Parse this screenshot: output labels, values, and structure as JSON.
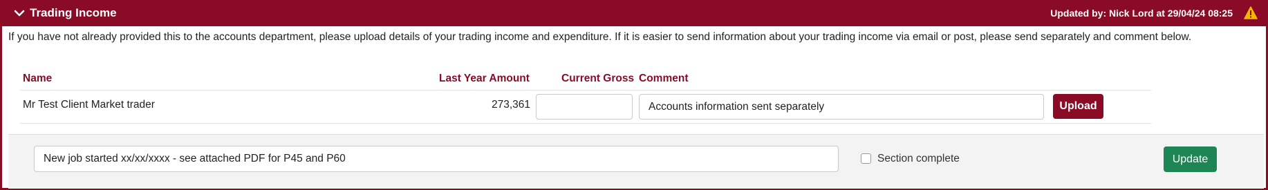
{
  "header": {
    "title": "Trading Income",
    "updated_text": "Updated by: Nick Lord at 29/04/24 08:25",
    "icons": {
      "collapse": "chevron-down-icon",
      "warning": "warning-icon"
    },
    "colors": {
      "brand": "#8a0b26",
      "warning": "#f2b705"
    }
  },
  "intro": "If you have not already provided this to the accounts department, please upload details of your trading income and expenditure. If it is easier to send information about your trading income via email or post, please send separately and comment below.",
  "table": {
    "columns": [
      "Name",
      "Last Year Amount",
      "Current Gross",
      "Comment"
    ],
    "rows": [
      {
        "name": "Mr Test Client Market trader",
        "last_year_amount": "273,361",
        "current_gross": "",
        "comment": "Accounts information sent separately",
        "upload_label": "Upload"
      }
    ]
  },
  "footer": {
    "note_value": "New job started xx/xx/xxxx - see attached PDF for P45 and P60",
    "section_complete_label": "Section complete",
    "section_complete_checked": false,
    "update_label": "Update",
    "update_color": "#1e8554"
  }
}
